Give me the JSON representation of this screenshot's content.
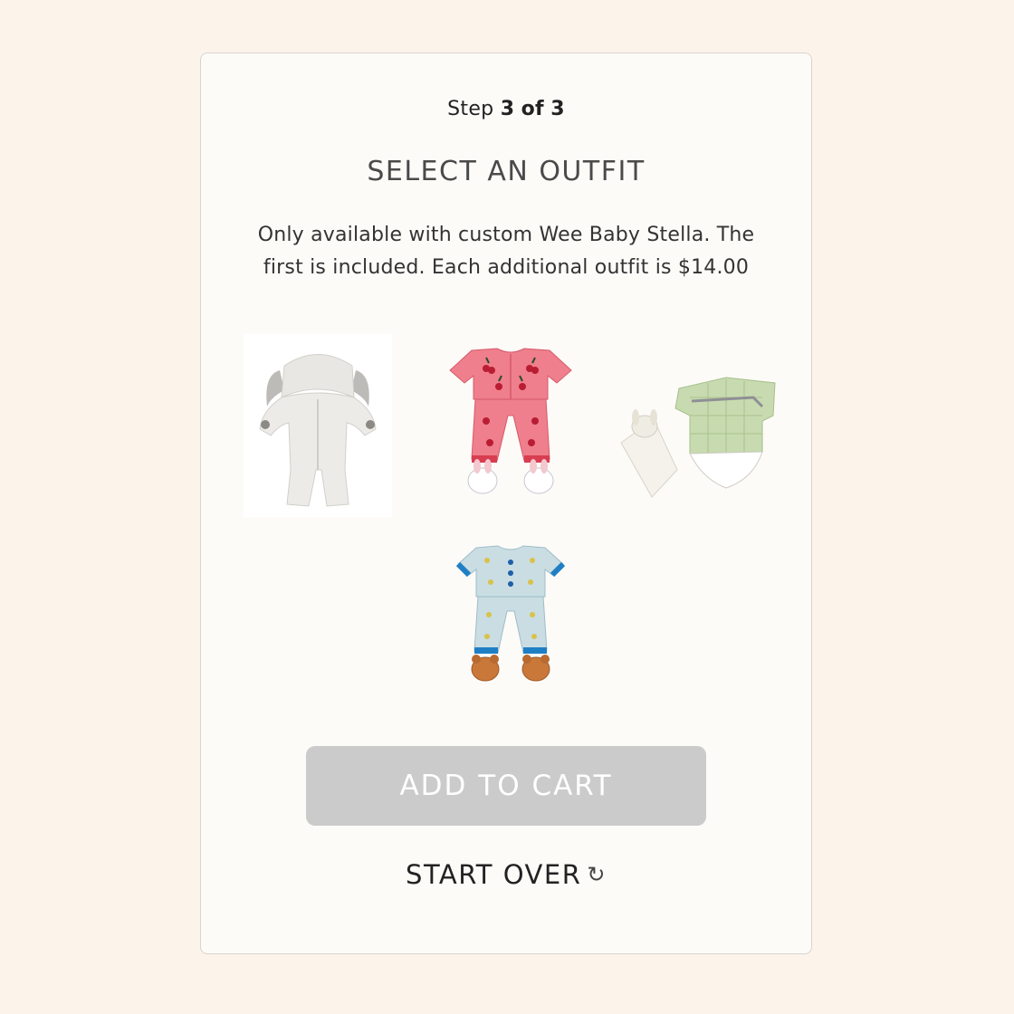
{
  "step": {
    "prefix": "Step",
    "current": "3",
    "of": "of",
    "total": "3"
  },
  "title": "SELECT AN OUTFIT",
  "description": "Only available with custom Wee Baby Stella. The first is included. Each additional outfit is $14.00",
  "outfits": [
    {
      "icon": "bunny-suit-icon"
    },
    {
      "icon": "cherry-pajamas-icon"
    },
    {
      "icon": "gingham-outfit-lovey-icon"
    },
    {
      "icon": "blue-pajamas-bear-slippers-icon"
    }
  ],
  "actions": {
    "add_to_cart": "ADD TO CART",
    "start_over": "START OVER",
    "start_over_icon": "refresh-icon"
  },
  "colors": {
    "page_background": "#fcf3ea",
    "card_background": "#fdfbf8",
    "button_disabled": "#cbcbcb",
    "button_text": "#ffffff"
  }
}
